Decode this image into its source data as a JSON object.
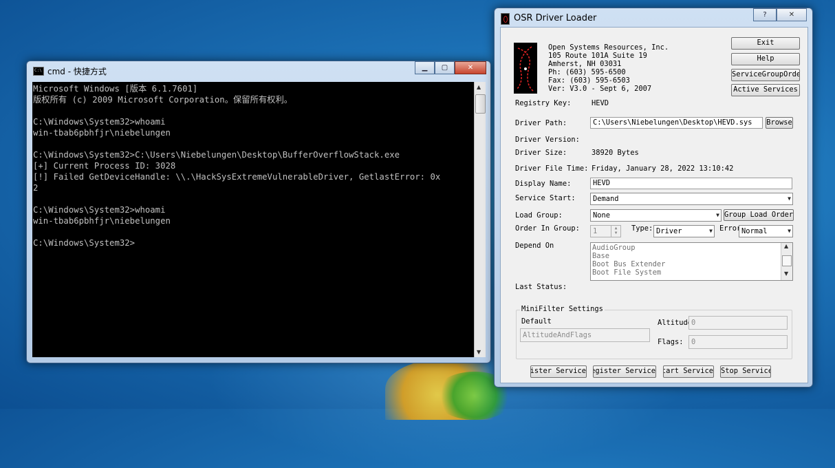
{
  "cmd": {
    "title": "cmd - 快捷方式",
    "lines": [
      "Microsoft Windows [版本 6.1.7601]",
      "版权所有 (c) 2009 Microsoft Corporation。保留所有权利。",
      "",
      "C:\\Windows\\System32>whoami",
      "win-tbab6pbhfjr\\niebelungen",
      "",
      "C:\\Windows\\System32>C:\\Users\\Niebelungen\\Desktop\\BufferOverflowStack.exe",
      "[+] Current Process ID: 3028",
      "[!] Failed GetDeviceHandle: \\\\.\\HackSysExtremeVulnerableDriver, GetlastError: 0x",
      "2",
      "",
      "C:\\Windows\\System32>whoami",
      "win-tbab6pbhfjr\\niebelungen",
      "",
      "C:\\Windows\\System32>"
    ],
    "minimize": "▁",
    "maximize": "▢",
    "close": "✕"
  },
  "osr": {
    "title": "OSR Driver Loader",
    "help_glyph": "?",
    "close_glyph": "✕",
    "company": {
      "name": "Open Systems Resources, Inc.",
      "address1": "105 Route 101A Suite 19",
      "address2": "Amherst, NH 03031",
      "phone": "Ph:  (603) 595-6500",
      "fax": "Fax: (603) 595-6503",
      "version": "Ver: V3.0  -  Sept 6, 2007"
    },
    "buttons": {
      "exit": "Exit",
      "help": "Help",
      "service_group_order": "ServiceGroupOrder",
      "active_services": "Active Services",
      "browse": "Browse",
      "group_load_order": "Group Load Order",
      "register_service": "Register Service",
      "unregister_service": "Unregister Service",
      "start_service": "Start Service",
      "stop_service": "Stop Service"
    },
    "labels": {
      "registry_key": "Registry Key:",
      "driver_path": "Driver Path:",
      "driver_version": "Driver Version:",
      "driver_size": "Driver Size:",
      "driver_file_time": "Driver File Time:",
      "display_name": "Display Name:",
      "service_start": "Service Start:",
      "load_group": "Load Group:",
      "order_in_group": "Order In Group:",
      "type": "Type:",
      "error": "Error",
      "depend_on": "Depend On",
      "last_status": "Last Status:",
      "minifilter_settings": "MiniFilter Settings",
      "default": "Default",
      "altitude": "Altitude",
      "flags": "Flags:"
    },
    "values": {
      "registry_key": "HEVD",
      "driver_path": "C:\\Users\\Niebelungen\\Desktop\\HEVD.sys",
      "driver_size": "38920 Bytes",
      "driver_file_time": "Friday, January 28, 2022 13:10:42",
      "display_name": "HEVD",
      "service_start": "Demand",
      "load_group": "None",
      "order_in_group": "1",
      "type": "Driver",
      "error": "Normal",
      "default_field": "AltitudeAndFlags",
      "altitude": "0",
      "flags": "0"
    },
    "depend_on_items": [
      "AudioGroup",
      "Base",
      "Boot Bus Extender",
      "Boot File System"
    ]
  }
}
